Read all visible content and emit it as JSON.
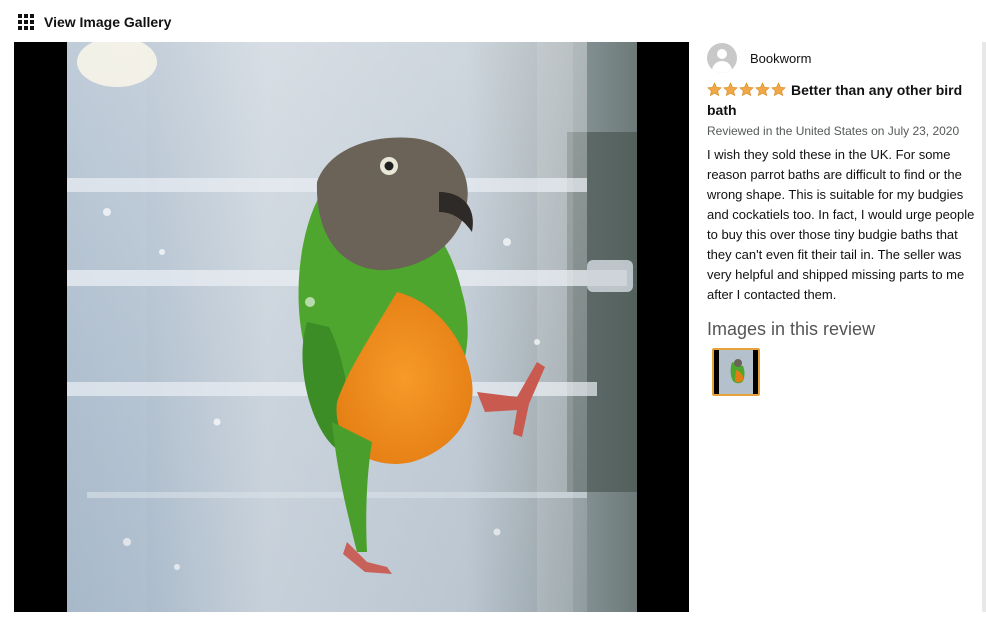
{
  "header": {
    "gallery_label": "View Image Gallery",
    "grid_icon": "grid-icon"
  },
  "review": {
    "reviewer_name": "Bookworm",
    "avatar_icon": "user-avatar-icon",
    "rating": 5,
    "rating_max": 5,
    "star_color": "#f3a847",
    "title": "Better than any other bird bath",
    "date": "Reviewed in the United States on July 23, 2020",
    "body": "I wish they sold these in the UK. For some reason parrot baths are difficult to find or the wrong shape. This is suitable for my budgies and cockatiels too. In fact, I would urge people to buy this over those tiny budgie baths that they can't even fit their tail in. The seller was very helpful and shipped missing parts to me after I contacted them.",
    "images_heading": "Images in this review",
    "thumbnail_count": 1
  },
  "colors": {
    "thumb_border": "#e7a33b",
    "muted_text": "#565959",
    "viewer_background": "#000000"
  }
}
